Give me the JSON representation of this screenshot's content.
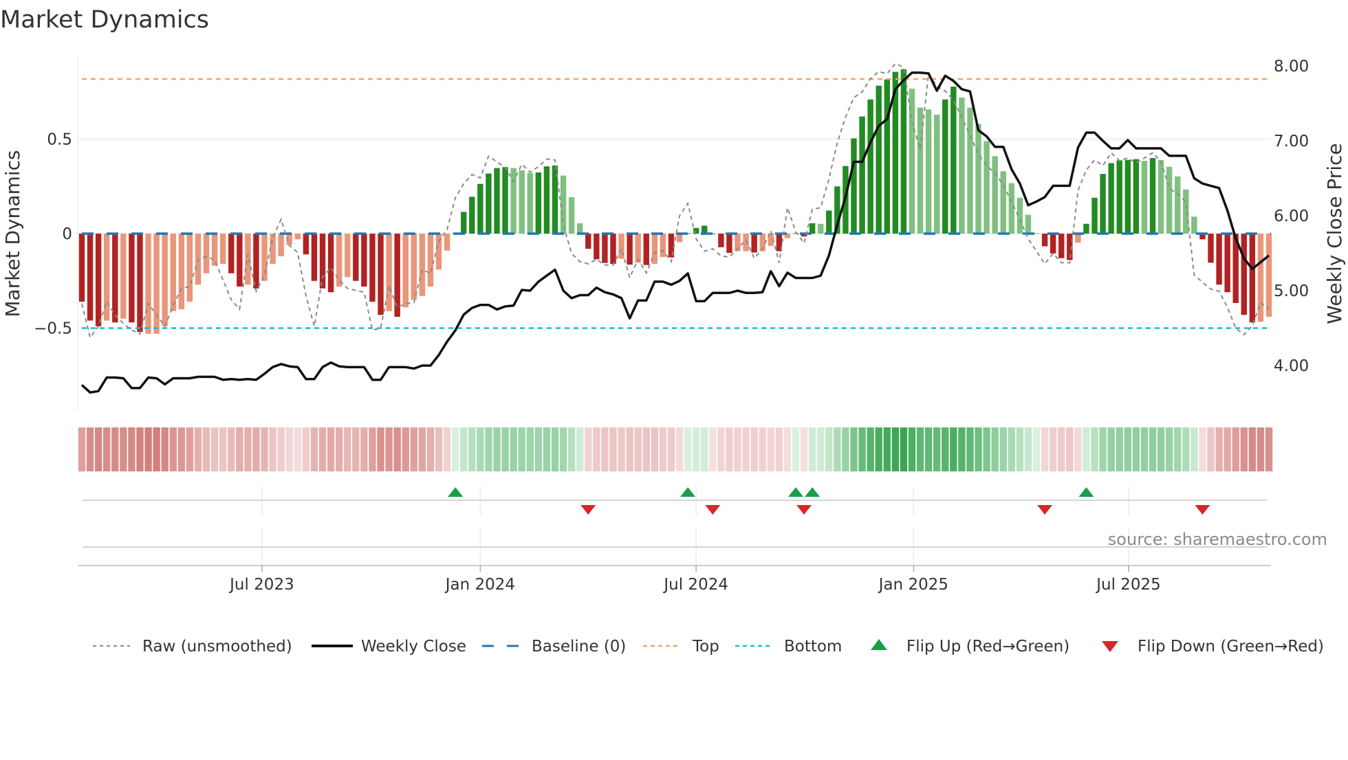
{
  "colors": {
    "bar_red_strong": "#b22222",
    "bar_red_weak": "#e9967a",
    "bar_green_strong": "#228b22",
    "bar_green_weak": "#80c080",
    "close_line": "#111111",
    "raw_line": "#8a8a8a",
    "baseline": "#1f77b4",
    "top": "#f4a460",
    "bottom": "#17becf",
    "flip_up": "#1a9e4a",
    "flip_down": "#d62728"
  },
  "chart_data": {
    "type": "bar",
    "title": "Market Dynamics",
    "ylabel": "Market Dynamics",
    "y2label": "Weekly Close Price",
    "source": "source: sharemaestro.com",
    "ylim": [
      -0.9,
      1.0
    ],
    "y2lim": [
      3.4,
      8.15
    ],
    "yticks": [
      {
        "v": 0.5,
        "label": "0.5"
      },
      {
        "v": 0,
        "label": "0"
      },
      {
        "v": -0.5,
        "label": "−0.5"
      }
    ],
    "y2ticks": [
      {
        "v": 8,
        "label": "8.00"
      },
      {
        "v": 7,
        "label": "7.00"
      },
      {
        "v": 6,
        "label": "6.00"
      },
      {
        "v": 5,
        "label": "5.00"
      },
      {
        "v": 4,
        "label": "4.00"
      }
    ],
    "xticks": [
      {
        "week": 21.7,
        "label": "Jul 2023"
      },
      {
        "week": 48.0,
        "label": "Jan 2024"
      },
      {
        "week": 74.0,
        "label": "Jul 2024"
      },
      {
        "week": 100.2,
        "label": "Jan 2025"
      },
      {
        "week": 126.1,
        "label": "Jul 2025"
      }
    ],
    "levels": {
      "baseline": 0,
      "top": 0.818,
      "bottom": -0.5
    },
    "dynamics": [
      -0.36,
      -0.46,
      -0.49,
      -0.46,
      -0.47,
      -0.45,
      -0.47,
      -0.52,
      -0.53,
      -0.53,
      -0.49,
      -0.41,
      -0.4,
      -0.36,
      -0.27,
      -0.21,
      -0.17,
      -0.16,
      -0.21,
      -0.28,
      -0.27,
      -0.29,
      -0.25,
      -0.16,
      -0.12,
      -0.06,
      -0.03,
      -0.11,
      -0.25,
      -0.29,
      -0.31,
      -0.28,
      -0.23,
      -0.25,
      -0.28,
      -0.36,
      -0.43,
      -0.41,
      -0.44,
      -0.39,
      -0.35,
      -0.33,
      -0.28,
      -0.19,
      -0.09,
      0.003,
      0.115,
      0.195,
      0.263,
      0.318,
      0.347,
      0.352,
      0.347,
      0.335,
      0.321,
      0.324,
      0.356,
      0.361,
      0.307,
      0.193,
      0.055,
      -0.08,
      -0.136,
      -0.155,
      -0.16,
      -0.133,
      -0.164,
      -0.154,
      -0.166,
      -0.16,
      -0.124,
      -0.126,
      -0.045,
      0.003,
      0.03,
      0.042,
      -0.003,
      -0.072,
      -0.102,
      -0.093,
      -0.093,
      -0.1,
      -0.093,
      -0.065,
      -0.093,
      -0.024,
      0.003,
      -0.015,
      0.055,
      0.052,
      0.122,
      0.25,
      0.358,
      0.504,
      0.62,
      0.71,
      0.783,
      0.816,
      0.856,
      0.87,
      0.767,
      0.667,
      0.657,
      0.63,
      0.71,
      0.778,
      0.72,
      0.667,
      0.58,
      0.49,
      0.41,
      0.33,
      0.267,
      0.19,
      0.1,
      0.003,
      -0.067,
      -0.105,
      -0.13,
      -0.14,
      -0.048,
      0.052,
      0.19,
      0.316,
      0.373,
      0.388,
      0.39,
      0.394,
      0.385,
      0.4,
      0.39,
      0.354,
      0.303,
      0.234,
      0.09,
      -0.03,
      -0.154,
      -0.27,
      -0.31,
      -0.367,
      -0.43,
      -0.47,
      -0.466,
      -0.44
    ],
    "strengthening": [
      1,
      1,
      1,
      0,
      1,
      0,
      1,
      1,
      0,
      0,
      0,
      0,
      0,
      0,
      0,
      0,
      0,
      0,
      1,
      1,
      0,
      1,
      0,
      0,
      0,
      0,
      0,
      1,
      1,
      1,
      1,
      0,
      0,
      1,
      1,
      1,
      1,
      0,
      1,
      0,
      0,
      0,
      0,
      0,
      0,
      1,
      1,
      1,
      1,
      1,
      1,
      1,
      0,
      0,
      0,
      1,
      1,
      1,
      0,
      0,
      0,
      1,
      1,
      1,
      1,
      0,
      1,
      0,
      1,
      0,
      0,
      1,
      0,
      1,
      1,
      1,
      1,
      1,
      1,
      0,
      0,
      1,
      0,
      0,
      1,
      0,
      1,
      1,
      1,
      0,
      1,
      1,
      1,
      1,
      1,
      1,
      1,
      1,
      1,
      1,
      0,
      0,
      0,
      0,
      1,
      1,
      0,
      0,
      0,
      0,
      0,
      0,
      0,
      0,
      0,
      0,
      1,
      1,
      1,
      1,
      0,
      1,
      1,
      1,
      1,
      1,
      1,
      1,
      0,
      1,
      0,
      0,
      0,
      0,
      0,
      1,
      1,
      1,
      1,
      1,
      1,
      1,
      0,
      0
    ],
    "raw": [
      -0.37,
      -0.55,
      -0.49,
      -0.36,
      -0.43,
      -0.475,
      -0.51,
      -0.53,
      -0.37,
      -0.43,
      -0.49,
      -0.38,
      -0.29,
      -0.28,
      -0.14,
      -0.12,
      -0.14,
      -0.245,
      -0.35,
      -0.4,
      -0.11,
      -0.305,
      -0.22,
      -0.02,
      0.076,
      -0.063,
      -0.1,
      -0.33,
      -0.49,
      -0.23,
      -0.18,
      -0.245,
      -0.29,
      -0.3,
      -0.31,
      -0.51,
      -0.5,
      -0.275,
      -0.39,
      -0.37,
      -0.366,
      -0.19,
      -0.21,
      -0.04,
      0.022,
      0.19,
      0.264,
      0.313,
      0.295,
      0.41,
      0.38,
      0.35,
      0.276,
      0.367,
      0.325,
      0.355,
      0.395,
      0.39,
      0.046,
      -0.105,
      -0.148,
      -0.16,
      -0.136,
      -0.166,
      -0.166,
      -0.08,
      -0.233,
      -0.136,
      -0.208,
      -0.1,
      -0.09,
      -0.148,
      0.095,
      0.16,
      -0.027,
      -0.093,
      -0.08,
      -0.118,
      -0.124,
      -0.08,
      -0.033,
      -0.13,
      -0.08,
      0.016,
      -0.154,
      0.137,
      0.01,
      -0.05,
      0.13,
      0.137,
      0.29,
      0.48,
      0.616,
      0.72,
      0.75,
      0.82,
      0.858,
      0.846,
      0.9,
      0.88,
      0.59,
      0.446,
      0.846,
      0.78,
      0.755,
      0.707,
      0.616,
      0.52,
      0.42,
      0.36,
      0.32,
      0.258,
      0.167,
      0.076,
      -0.027,
      -0.093,
      -0.16,
      -0.105,
      -0.154,
      -0.154,
      0.228,
      0.337,
      0.39,
      0.36,
      0.428,
      0.385,
      0.4,
      0.373,
      0.4,
      0.428,
      0.38,
      0.24,
      0.21,
      0.167,
      -0.22,
      -0.257,
      -0.293,
      -0.305,
      -0.39,
      -0.5,
      -0.535,
      -0.487,
      -0.366,
      -0.4
    ],
    "weekly_close": [
      3.74,
      3.64,
      3.66,
      3.84,
      3.84,
      3.83,
      3.7,
      3.7,
      3.84,
      3.83,
      3.75,
      3.83,
      3.83,
      3.83,
      3.85,
      3.85,
      3.85,
      3.81,
      3.82,
      3.81,
      3.82,
      3.81,
      3.89,
      3.98,
      4.02,
      3.99,
      3.98,
      3.82,
      3.82,
      3.98,
      4.04,
      3.99,
      3.98,
      3.98,
      3.98,
      3.81,
      3.81,
      3.98,
      3.98,
      3.98,
      3.96,
      4.0,
      4.0,
      4.14,
      4.32,
      4.47,
      4.68,
      4.77,
      4.81,
      4.81,
      4.75,
      4.79,
      4.8,
      5.01,
      5.0,
      5.12,
      5.2,
      5.28,
      5.0,
      4.9,
      4.94,
      4.94,
      5.04,
      4.98,
      4.95,
      4.9,
      4.63,
      4.87,
      4.87,
      5.12,
      5.12,
      5.08,
      5.13,
      5.23,
      4.86,
      4.86,
      4.97,
      4.97,
      4.97,
      5.0,
      4.97,
      4.97,
      4.98,
      5.26,
      5.06,
      5.24,
      5.17,
      5.17,
      5.17,
      5.2,
      5.47,
      5.88,
      6.25,
      6.72,
      6.72,
      6.98,
      7.2,
      7.29,
      7.69,
      7.81,
      7.91,
      7.91,
      7.9,
      7.67,
      7.87,
      7.8,
      7.69,
      7.66,
      7.14,
      7.06,
      6.92,
      6.92,
      6.62,
      6.43,
      6.14,
      6.19,
      6.25,
      6.4,
      6.4,
      6.4,
      6.91,
      7.11,
      7.11,
      7.0,
      6.9,
      6.9,
      7.01,
      6.9,
      6.9,
      6.9,
      6.9,
      6.8,
      6.8,
      6.8,
      6.5,
      6.43,
      6.4,
      6.37,
      6.07,
      5.7,
      5.43,
      5.29,
      5.38,
      5.47
    ],
    "flip_up_weeks": [
      45,
      73,
      86,
      88,
      121
    ],
    "flip_down_weeks": [
      61,
      76,
      87,
      116,
      135
    ],
    "legend": [
      {
        "key": "raw",
        "label": "Raw (unsmoothed)"
      },
      {
        "key": "close",
        "label": "Weekly Close"
      },
      {
        "key": "baseline",
        "label": "Baseline (0)"
      },
      {
        "key": "top",
        "label": "Top"
      },
      {
        "key": "bottom",
        "label": "Bottom"
      },
      {
        "key": "up",
        "label": "Flip Up (Red→Green)"
      },
      {
        "key": "down",
        "label": "Flip Down (Green→Red)"
      }
    ],
    "legend_position": "bottom"
  }
}
